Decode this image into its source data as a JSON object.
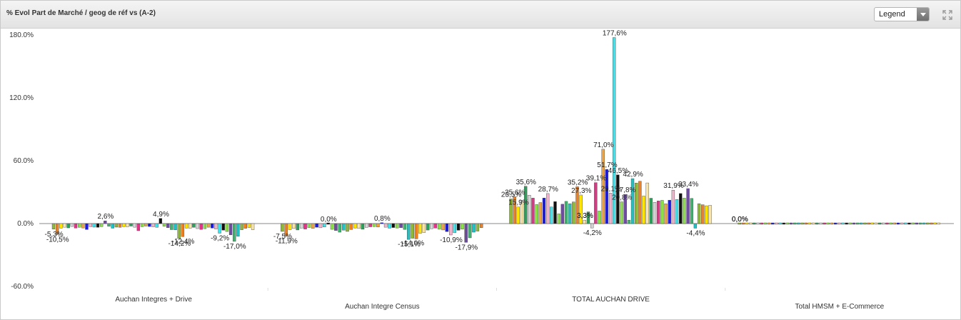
{
  "panel": {
    "title": "% Evol Part de Marché / geog de réf vs (A-2)"
  },
  "legend": {
    "label": "Legend",
    "icon": "chevron-down-icon"
  },
  "icons": {
    "expand": "expand-icon"
  },
  "chart_data": {
    "type": "bar",
    "ylim": [
      -60,
      180
    ],
    "yticks": [
      "180.0%",
      "120.0%",
      "60.0%",
      "0.0%",
      "-60.0%"
    ],
    "ytick_values": [
      180,
      120,
      60,
      0,
      -60
    ],
    "grid": false,
    "legend_position": "hidden",
    "colors": [
      "#8db83a",
      "#f07f1e",
      "#ffe600",
      "#fbe5a5",
      "#2ca05a",
      "#d5d5d5",
      "#e23386",
      "#8be04a",
      "#f2a23a",
      "#1b1bd8",
      "#efb4cc",
      "#3ce4ee",
      "#111111",
      "#8be04a",
      "#6d4c9f",
      "#3eb56e",
      "#22c0c0"
    ],
    "groups": [
      {
        "label": "Auchan Integres + Drive",
        "values": [
          -5.3,
          -10.5,
          -4.4,
          -3.5,
          -4.1,
          -2.8,
          -4.3,
          -3.6,
          -4.2,
          -5.7,
          -3.0,
          -3.4,
          -3.6,
          -2.9,
          2.6,
          -2.6,
          -4.4,
          -3.4,
          -3.6,
          -2.9,
          -3.1,
          -2.4,
          -3.5,
          -6.8,
          -3.0,
          -2.4,
          -2.8,
          -3.1,
          -3.6,
          4.9,
          -2.6,
          -3.9,
          -5.8,
          -6.0,
          -14.2,
          -12.4,
          -4.3,
          -4.5,
          -3.6,
          -4.8,
          -5.6,
          -4.9,
          -3.5,
          -4.3,
          -5.2,
          -9.2,
          -6.3,
          -7.6,
          -10.8,
          -17.0,
          -12.1,
          -5.9,
          -4.5,
          -3.8,
          -5.9
        ],
        "labels": [
          "-5,3%",
          "-10,5%",
          "2,6%",
          "4,9%",
          "-14,2%",
          "-12,4%",
          "-9,2%",
          "-17,0%"
        ]
      },
      {
        "label": "Auchan Integre Census",
        "values": [
          -7.5,
          -11.9,
          -5.8,
          -4.7,
          -6.1,
          -4.4,
          -5.2,
          -3.8,
          -4.6,
          -3.5,
          -4.0,
          -3.2,
          0.0,
          -5.5,
          -6.6,
          -8.2,
          -6.3,
          -7.5,
          -5.7,
          -4.2,
          -4.6,
          -5.4,
          -3.7,
          -3.1,
          -2.9,
          -3.3,
          0.8,
          -3.5,
          -4.4,
          -3.8,
          -4.2,
          -3.9,
          -5.6,
          -15.1,
          -14.0,
          -14.6,
          -9.3,
          -8.6,
          -6.2,
          -4.9,
          -4.3,
          -5.4,
          -6.1,
          -7.7,
          -10.9,
          -8.8,
          -6.4,
          -5.3,
          -17.9,
          -13.6,
          -8.2,
          -7.2,
          -3.9
        ],
        "labels": [
          "-7,5%",
          "-11,9%",
          "0,0%",
          "0,8%",
          "-15,1%",
          "-14,0%",
          "-10,9%",
          "-17,9%"
        ]
      },
      {
        "label": "TOTAL AUCHAN DRIVE",
        "values": [
          23.5,
          25.6,
          15.9,
          22.0,
          35.6,
          27.1,
          24.3,
          18.2,
          20.1,
          24.4,
          28.7,
          15.9,
          21.0,
          9.3,
          18.5,
          21.2,
          19.0,
          20.7,
          35.2,
          27.3,
          3.3,
          11.2,
          -4.2,
          39.1,
          12.0,
          71.0,
          51.7,
          29.1,
          177.6,
          46.5,
          20.8,
          27.8,
          3.3,
          42.9,
          38.7,
          40.4,
          26.3,
          38.8,
          24.2,
          20.3,
          21.6,
          22.2,
          18.9,
          22.3,
          31.9,
          23.0,
          28.7,
          24.3,
          33.4,
          24.0,
          -4.4,
          19.0,
          18.0,
          17.0,
          17.5
        ],
        "labels": [
          "23,5%",
          "25,6%",
          "15,9%",
          "35,6%",
          "28,7%",
          "35,2%",
          "27,3%",
          "3,3%",
          "-4,2%",
          "39,1%",
          "71,0%",
          "51,7%",
          "29,1%",
          "177,6%",
          "46,5%",
          "27,8%",
          "20,8%",
          "3,3%",
          "42,9%",
          "31,9%",
          "33,4%",
          "-4,4%"
        ]
      },
      {
        "label": "Total HMSM + E-Commerce",
        "values": [
          0,
          0,
          0,
          0,
          0,
          0,
          0,
          0,
          0,
          0,
          0,
          0,
          0,
          0,
          0,
          0,
          0,
          0,
          0,
          0,
          0,
          0,
          0,
          0,
          0,
          0,
          0,
          0,
          0,
          0,
          0,
          0,
          0,
          0,
          0,
          0,
          0,
          0,
          0,
          0,
          0,
          0,
          0,
          0,
          0,
          0,
          0,
          0,
          0,
          0,
          0,
          0,
          0,
          0,
          0
        ],
        "labels": [
          "0,0%",
          "0,0%",
          "0,0%"
        ]
      }
    ]
  }
}
